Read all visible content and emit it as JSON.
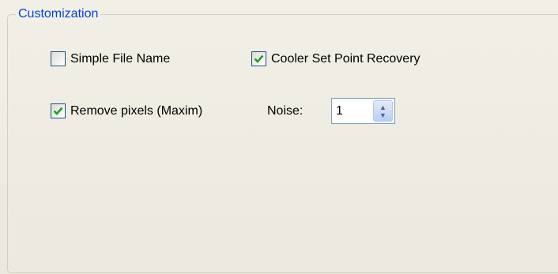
{
  "group": {
    "title": "Customization"
  },
  "options": {
    "simple_file_name": {
      "label": "Simple File Name",
      "checked": false
    },
    "cooler_set_point_recovery": {
      "label": "Cooler Set Point Recovery",
      "checked": true
    },
    "remove_pixels": {
      "label": "Remove pixels (Maxim)",
      "checked": true
    }
  },
  "noise": {
    "label": "Noise:",
    "value": "1"
  },
  "colors": {
    "legend_text": "#0046d5",
    "check_mark": "#21a121",
    "checkbox_border": "#1c5180",
    "panel_bg": "#ece9d8"
  },
  "icons": {
    "checkbox_check": "check-icon",
    "spin_up": "chevron-up-icon",
    "spin_down": "chevron-down-icon"
  }
}
